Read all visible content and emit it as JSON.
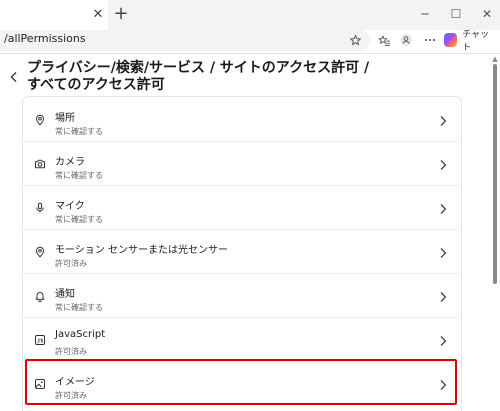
{
  "browser": {
    "tab_close_glyph": "✕",
    "new_tab_glyph": "+",
    "controls": {
      "minimize": "─",
      "maximize": "☐",
      "close": "✕"
    },
    "address": "/allPermissions",
    "copilot_label": "チャット"
  },
  "page": {
    "breadcrumb_line1": "プライバシー/検索/サービス / サイトのアクセス許可 /",
    "breadcrumb_line2": "すべてのアクセス許可"
  },
  "permissions": [
    {
      "title": "場所",
      "sub": "常に確認する",
      "icon": "location-icon"
    },
    {
      "title": "カメラ",
      "sub": "常に確認する",
      "icon": "camera-icon"
    },
    {
      "title": "マイク",
      "sub": "常に確認する",
      "icon": "microphone-icon"
    },
    {
      "title": "モーション センサーまたは光センサー",
      "sub": "許可済み",
      "icon": "sensor-icon"
    },
    {
      "title": "通知",
      "sub": "常に確認する",
      "icon": "bell-icon"
    },
    {
      "title": "JavaScript",
      "sub": "許可済み",
      "icon": "javascript-icon"
    },
    {
      "title": "イメージ",
      "sub": "許可済み",
      "icon": "image-icon"
    }
  ],
  "colors": {
    "highlight": "#e00000"
  }
}
